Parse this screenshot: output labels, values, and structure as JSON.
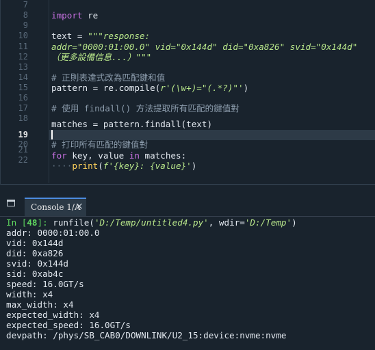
{
  "editor": {
    "line_numbers": [
      "7",
      "8",
      "9",
      "10",
      "11",
      "12",
      "13",
      "14",
      "15",
      "16",
      "17",
      "18",
      "19",
      "20",
      "21",
      "22"
    ],
    "current_line": "19",
    "lines": {
      "l8_kw": "import",
      "l8_mod": " re",
      "l10_a": "text",
      "l10_b": " = ",
      "l10_str": "\"\"\"response:",
      "l11_str": "addr=\"0000:01:00.0\" vid=\"0x144d\" did=\"0xa826\" svid=\"0x144d\"",
      "l12_str": "（更多設備信息...）\"\"\"",
      "l14_cmt": "# 正則表達式改為匹配鍵和值",
      "l15_a": "pattern",
      "l15_b": " = re.compile(",
      "l15_str": "r'(\\w+)=\"(.*?)\"'",
      "l15_c": ")",
      "l17_cmt": "# 使用 findall() 方法提取所有匹配的鍵值對",
      "l18_code": "matches = pattern.findall(text)",
      "l20_cmt": "# 打印所有匹配的鍵值對",
      "l21_kw1": "for",
      "l21_a": " key, value ",
      "l21_kw2": "in",
      "l21_b": " matches:",
      "l22_indent": "····",
      "l22_fn": "print",
      "l22_a": "(",
      "l22_str": "f'{key}: {value}'",
      "l22_b": ")"
    }
  },
  "console_panel": {
    "tab_label": "Console 1/A",
    "close_glyph": "×",
    "undock_icon": "undock-icon"
  },
  "console": {
    "prompt_in": "In [",
    "prompt_num": "48",
    "prompt_end": "]:",
    "cmd_a": " runfile(",
    "cmd_path": "'D:/Temp/untitled4.py'",
    "cmd_b": ", wdir=",
    "cmd_wdir": "'D:/Temp'",
    "cmd_c": ")",
    "output": [
      "addr: 0000:01:00.0",
      "vid: 0x144d",
      "did: 0xa826",
      "svid: 0x144d",
      "sid: 0xab4c",
      "speed: 16.0GT/s",
      "width: x4",
      "max_width: x4",
      "expected_width: x4",
      "expected_speed: 16.0GT/s",
      "devpath: /phys/SB_CAB0/DOWNLINK/U2_15:device:nvme:nvme"
    ]
  }
}
